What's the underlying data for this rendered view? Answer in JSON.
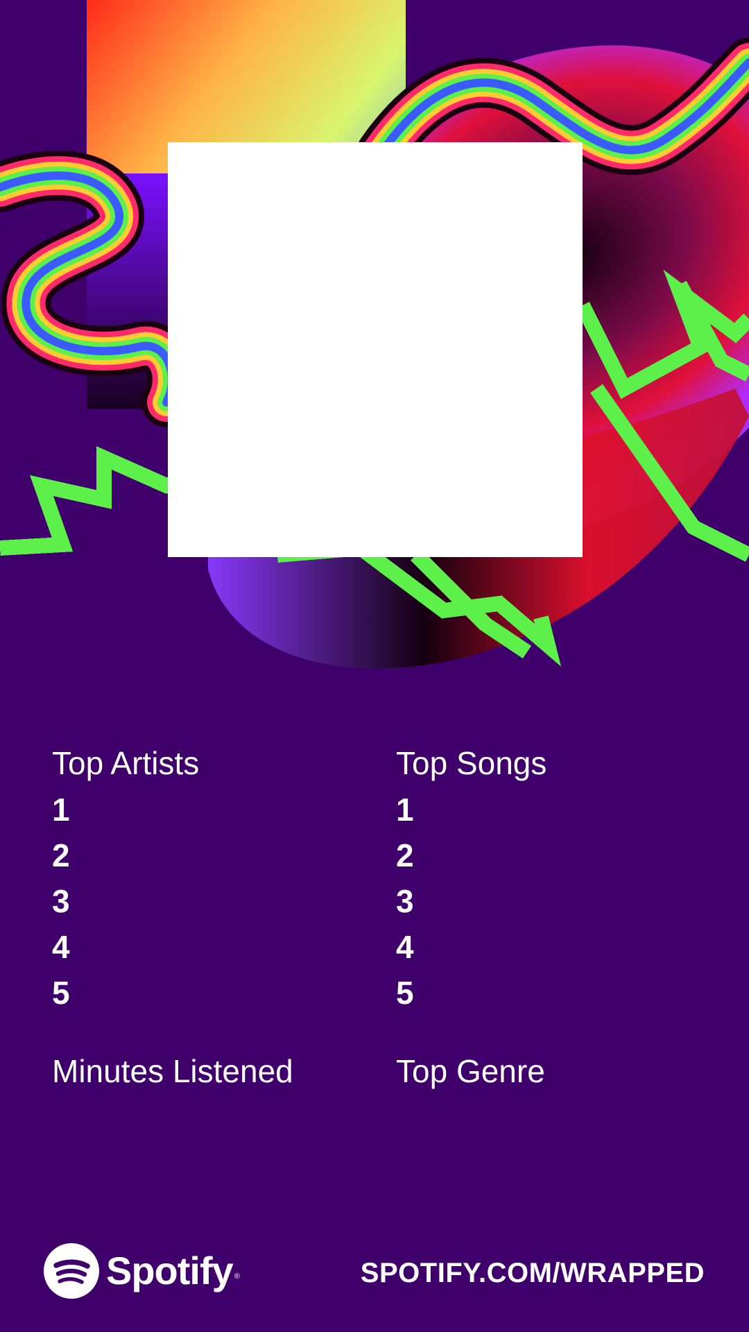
{
  "columns": {
    "left": {
      "heading": "Top Artists",
      "ranks": [
        "1",
        "2",
        "3",
        "4",
        "5"
      ]
    },
    "right": {
      "heading": "Top Songs",
      "ranks": [
        "1",
        "2",
        "3",
        "4",
        "5"
      ]
    }
  },
  "stats": {
    "minutes_heading": "Minutes Listened",
    "genre_heading": "Top Genre"
  },
  "footer": {
    "brand": "Spotify",
    "registered_mark": "®",
    "url": "SPOTIFY.COM/WRAPPED"
  },
  "icons": {
    "logo": "spotify-logo-icon"
  },
  "colors": {
    "background": "#3f006b",
    "text": "#ffffff",
    "accent_green": "#5ef04a",
    "photo_frame": "#ffffff"
  }
}
